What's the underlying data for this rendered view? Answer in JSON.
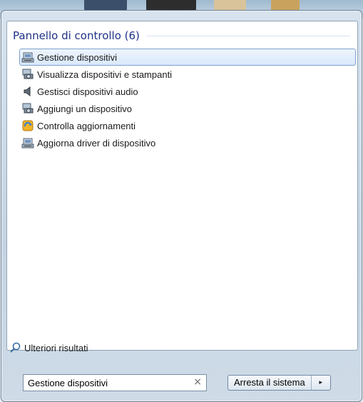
{
  "group": {
    "title": "Pannello di controllo (6)"
  },
  "results": [
    {
      "label": "Gestione dispositivi",
      "icon": "device-manager-icon",
      "selected": true
    },
    {
      "label": "Visualizza dispositivi e stampanti",
      "icon": "devices-printers-icon",
      "selected": false
    },
    {
      "label": "Gestisci dispositivi audio",
      "icon": "speaker-icon",
      "selected": false
    },
    {
      "label": "Aggiungi un dispositivo",
      "icon": "add-device-icon",
      "selected": false
    },
    {
      "label": "Controlla aggiornamenti",
      "icon": "windows-update-icon",
      "selected": false
    },
    {
      "label": "Aggiorna driver di dispositivo",
      "icon": "driver-update-icon",
      "selected": false
    }
  ],
  "more_results": {
    "label": "Ulteriori risultati",
    "icon": "search-icon"
  },
  "search": {
    "value": "Gestione dispositivi",
    "clear_glyph": "×"
  },
  "shutdown": {
    "label": "Arresta il sistema",
    "arrow_glyph": "▸"
  },
  "colors": {
    "header": "#1e3287",
    "selection_border": "#7da2ce"
  }
}
